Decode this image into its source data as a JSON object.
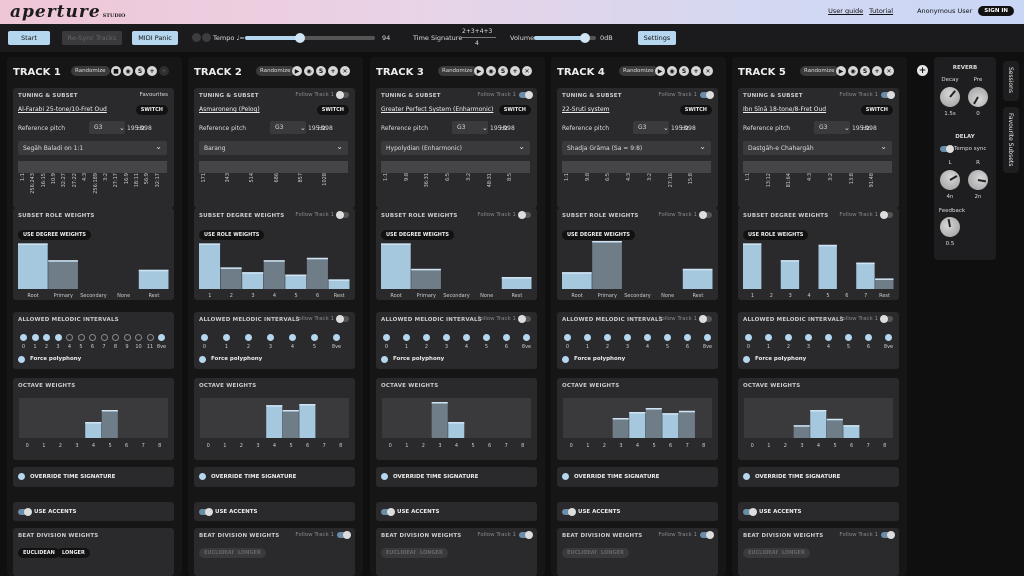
{
  "header": {
    "logo": "aperture",
    "logo_sub": "STUDIO",
    "user_guide": "User guide",
    "tutorial": "Tutorial",
    "user": "Anonymous User",
    "sign_in": "SIGN IN"
  },
  "controls": {
    "start": "Start",
    "sync": "Re-Sync Tracks",
    "panic": "MIDI Panic",
    "tempo_label": "Tempo ♩=",
    "tempo_value": "94",
    "tempo_fraction": 0.42,
    "ts_label": "Time Signature",
    "ts_top": "2+3+4+3",
    "ts_bottom": "4",
    "volume_label": "Volume",
    "volume_value": "0dB",
    "volume_fraction": 0.82,
    "settings": "Settings"
  },
  "common": {
    "randomize": "Randomize",
    "tuning": "TUNING & SUBSET",
    "switch": "SWITCH",
    "ref_pitch": "Reference pitch",
    "hz": "Hz",
    "subset_role": "SUBSET ROLE WEIGHTS",
    "subset_degree": "SUBSET DEGREE WEIGHTS",
    "use_degree": "USE DEGREE WEIGHTS",
    "use_role": "USE ROLE WEIGHTS",
    "intervals": "ALLOWED MELODIC INTERVALS",
    "force_poly": "Force polyphony",
    "octave": "OCTAVE WEIGHTS",
    "override_ts": "OVERRIDE TIME SIGNATURE",
    "accents": "USE ACCENTS",
    "beat_div": "BEAT DIVISION WEIGHTS",
    "euclidean": "EUCLIDEAN",
    "longer": "LONGER",
    "follow": "Follow Track 1",
    "favourites": "Favourites"
  },
  "tracks": [
    {
      "name": "TRACK 1",
      "tuning": "Al-Farabi 25-tone/10-Fret Oud",
      "note": "G3",
      "ref": "195.998",
      "subset": "Segāh Baladi on 1:1",
      "ratios": [
        "1:1",
        "256:243",
        "16:15",
        "10:9",
        "32:27",
        "27:22",
        "4:3",
        "256:189",
        "3:2",
        "27:17",
        "16:9",
        "18:11",
        "56:9",
        "32:17"
      ],
      "weights_type": "role",
      "weight_cats": [
        "Root",
        "Primary",
        "Secondary",
        "None",
        "Rest"
      ],
      "weights": [
        0.95,
        0.6,
        0,
        0,
        0.4
      ],
      "intervals": [
        "0",
        "1",
        "2",
        "3",
        "4",
        "5",
        "6",
        "7",
        "8",
        "9",
        "10",
        "11",
        "8ve"
      ],
      "octaves": [
        "0",
        "1",
        "2",
        "3",
        "4",
        "5",
        "6",
        "7",
        "8"
      ],
      "oct_weights": [
        0,
        0,
        0,
        0,
        0.4,
        0.7,
        0,
        0,
        0
      ]
    },
    {
      "name": "TRACK 2",
      "tuning": "Asmaroneng (Pelog)",
      "note": "G3",
      "ref": "195.998",
      "subset": "Barang",
      "ratios": [
        "171",
        "343",
        "514",
        "686",
        "857",
        "1028"
      ],
      "weights_type": "degree",
      "weight_cats": [
        "1",
        "2",
        "3",
        "4",
        "5",
        "6",
        "Rest"
      ],
      "weights": [
        0.95,
        0.45,
        0.35,
        0.6,
        0.3,
        0.65,
        0.2
      ],
      "intervals": [
        "0",
        "1",
        "2",
        "3",
        "4",
        "5",
        "8ve"
      ],
      "octaves": [
        "0",
        "1",
        "2",
        "3",
        "4",
        "5",
        "6",
        "7",
        "8"
      ],
      "oct_weights": [
        0,
        0,
        0,
        0,
        0.82,
        0.7,
        0.85,
        0,
        0
      ]
    },
    {
      "name": "TRACK 3",
      "tuning": "Greater Perfect System (Enharmonic)",
      "note": "G3",
      "ref": "195.998",
      "subset": "Hypolydian (Enharmonic)",
      "ratios": [
        "1:1",
        "9:8",
        "36:31",
        "6:5",
        "3:2",
        "48:31",
        "8:5"
      ],
      "weights_type": "role",
      "weight_cats": [
        "Root",
        "Primary",
        "Secondary",
        "None",
        "Rest"
      ],
      "weights": [
        0.95,
        0.42,
        0,
        0,
        0.25
      ],
      "intervals": [
        "0",
        "1",
        "2",
        "3",
        "4",
        "5",
        "6",
        "8ve"
      ],
      "octaves": [
        "0",
        "1",
        "2",
        "3",
        "4",
        "5",
        "6",
        "7",
        "8"
      ],
      "oct_weights": [
        0,
        0,
        0,
        0.9,
        0.4,
        0,
        0,
        0,
        0
      ]
    },
    {
      "name": "TRACK 4",
      "tuning": "22-Sruti system",
      "note": "G3",
      "ref": "195.998",
      "subset": "Shadja Grāma (Sa = 9:8)",
      "ratios": [
        "1:1",
        "9:8",
        "6:5",
        "4:3",
        "3:2",
        "27:16",
        "15:8"
      ],
      "weights_type": "role",
      "weight_cats": [
        "Root",
        "Primary",
        "Secondary",
        "None",
        "Rest"
      ],
      "weights": [
        0.35,
        1.0,
        0,
        0,
        0.42
      ],
      "intervals": [
        "0",
        "1",
        "2",
        "3",
        "4",
        "5",
        "6",
        "8ve"
      ],
      "octaves": [
        "0",
        "1",
        "2",
        "3",
        "4",
        "5",
        "6",
        "7",
        "8"
      ],
      "oct_weights": [
        0,
        0,
        0,
        0.5,
        0.65,
        0.75,
        0.62,
        0.68,
        0
      ]
    },
    {
      "name": "TRACK 5",
      "tuning": "Ibn Sīnā 18-tone/8-Fret Oud",
      "note": "G3",
      "ref": "195.998",
      "subset": "Dastgāh-e Chahargāh",
      "ratios": [
        "1:1",
        "13:12",
        "81:64",
        "4:3",
        "3:2",
        "13:8",
        "91:48"
      ],
      "weights_type": "degree",
      "weight_cats": [
        "1",
        "2",
        "3",
        "4",
        "5",
        "6",
        "7",
        "Rest"
      ],
      "weights": [
        0.95,
        0,
        0.6,
        0,
        0.92,
        0,
        0.55,
        0.22
      ],
      "intervals": [
        "0",
        "1",
        "2",
        "3",
        "4",
        "5",
        "6",
        "8ve"
      ],
      "octaves": [
        "0",
        "1",
        "2",
        "3",
        "4",
        "5",
        "6",
        "7",
        "8"
      ],
      "oct_weights": [
        0,
        0,
        0,
        0.32,
        0.7,
        0.48,
        0.32,
        0,
        0
      ]
    }
  ],
  "effects": {
    "reverb": "REVERB",
    "decay": "Decay",
    "pre": "Pre",
    "decay_val": "1.5s",
    "pre_val": "0",
    "delay": "DELAY",
    "tempo_sync": "Tempo sync",
    "l": "L",
    "r": "R",
    "l_val": "4n",
    "r_val": "2n",
    "feedback": "Feedback",
    "feedback_val": "0.5"
  },
  "side_tabs": {
    "sessions": "Sessions",
    "favourite_subsets": "Favourite Subsets"
  }
}
